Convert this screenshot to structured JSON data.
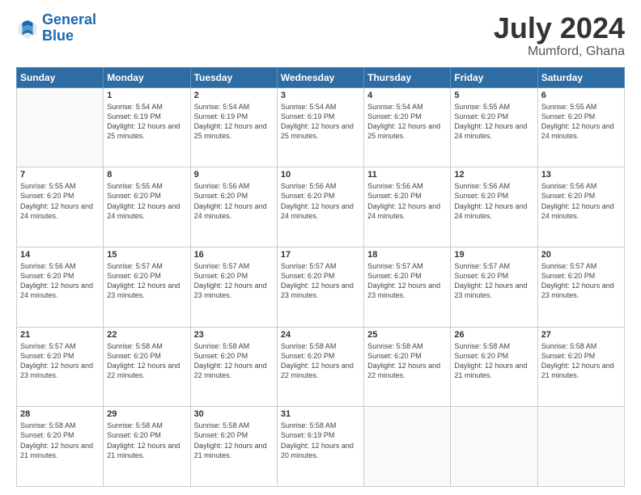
{
  "header": {
    "logo_line1": "General",
    "logo_line2": "Blue",
    "title": "July 2024",
    "subtitle": "Mumford, Ghana"
  },
  "weekdays": [
    "Sunday",
    "Monday",
    "Tuesday",
    "Wednesday",
    "Thursday",
    "Friday",
    "Saturday"
  ],
  "weeks": [
    [
      {
        "day": "",
        "info": ""
      },
      {
        "day": "1",
        "info": "Sunrise: 5:54 AM\nSunset: 6:19 PM\nDaylight: 12 hours\nand 25 minutes."
      },
      {
        "day": "2",
        "info": "Sunrise: 5:54 AM\nSunset: 6:19 PM\nDaylight: 12 hours\nand 25 minutes."
      },
      {
        "day": "3",
        "info": "Sunrise: 5:54 AM\nSunset: 6:19 PM\nDaylight: 12 hours\nand 25 minutes."
      },
      {
        "day": "4",
        "info": "Sunrise: 5:54 AM\nSunset: 6:20 PM\nDaylight: 12 hours\nand 25 minutes."
      },
      {
        "day": "5",
        "info": "Sunrise: 5:55 AM\nSunset: 6:20 PM\nDaylight: 12 hours\nand 24 minutes."
      },
      {
        "day": "6",
        "info": "Sunrise: 5:55 AM\nSunset: 6:20 PM\nDaylight: 12 hours\nand 24 minutes."
      }
    ],
    [
      {
        "day": "7",
        "info": ""
      },
      {
        "day": "8",
        "info": "Sunrise: 5:55 AM\nSunset: 6:20 PM\nDaylight: 12 hours\nand 24 minutes."
      },
      {
        "day": "9",
        "info": "Sunrise: 5:56 AM\nSunset: 6:20 PM\nDaylight: 12 hours\nand 24 minutes."
      },
      {
        "day": "10",
        "info": "Sunrise: 5:56 AM\nSunset: 6:20 PM\nDaylight: 12 hours\nand 24 minutes."
      },
      {
        "day": "11",
        "info": "Sunrise: 5:56 AM\nSunset: 6:20 PM\nDaylight: 12 hours\nand 24 minutes."
      },
      {
        "day": "12",
        "info": "Sunrise: 5:56 AM\nSunset: 6:20 PM\nDaylight: 12 hours\nand 24 minutes."
      },
      {
        "day": "13",
        "info": "Sunrise: 5:56 AM\nSunset: 6:20 PM\nDaylight: 12 hours\nand 24 minutes."
      }
    ],
    [
      {
        "day": "14",
        "info": ""
      },
      {
        "day": "15",
        "info": "Sunrise: 5:57 AM\nSunset: 6:20 PM\nDaylight: 12 hours\nand 23 minutes."
      },
      {
        "day": "16",
        "info": "Sunrise: 5:57 AM\nSunset: 6:20 PM\nDaylight: 12 hours\nand 23 minutes."
      },
      {
        "day": "17",
        "info": "Sunrise: 5:57 AM\nSunset: 6:20 PM\nDaylight: 12 hours\nand 23 minutes."
      },
      {
        "day": "18",
        "info": "Sunrise: 5:57 AM\nSunset: 6:20 PM\nDaylight: 12 hours\nand 23 minutes."
      },
      {
        "day": "19",
        "info": "Sunrise: 5:57 AM\nSunset: 6:20 PM\nDaylight: 12 hours\nand 23 minutes."
      },
      {
        "day": "20",
        "info": "Sunrise: 5:57 AM\nSunset: 6:20 PM\nDaylight: 12 hours\nand 23 minutes."
      }
    ],
    [
      {
        "day": "21",
        "info": ""
      },
      {
        "day": "22",
        "info": "Sunrise: 5:58 AM\nSunset: 6:20 PM\nDaylight: 12 hours\nand 22 minutes."
      },
      {
        "day": "23",
        "info": "Sunrise: 5:58 AM\nSunset: 6:20 PM\nDaylight: 12 hours\nand 22 minutes."
      },
      {
        "day": "24",
        "info": "Sunrise: 5:58 AM\nSunset: 6:20 PM\nDaylight: 12 hours\nand 22 minutes."
      },
      {
        "day": "25",
        "info": "Sunrise: 5:58 AM\nSunset: 6:20 PM\nDaylight: 12 hours\nand 22 minutes."
      },
      {
        "day": "26",
        "info": "Sunrise: 5:58 AM\nSunset: 6:20 PM\nDaylight: 12 hours\nand 21 minutes."
      },
      {
        "day": "27",
        "info": "Sunrise: 5:58 AM\nSunset: 6:20 PM\nDaylight: 12 hours\nand 21 minutes."
      }
    ],
    [
      {
        "day": "28",
        "info": "Sunrise: 5:58 AM\nSunset: 6:20 PM\nDaylight: 12 hours\nand 21 minutes."
      },
      {
        "day": "29",
        "info": "Sunrise: 5:58 AM\nSunset: 6:20 PM\nDaylight: 12 hours\nand 21 minutes."
      },
      {
        "day": "30",
        "info": "Sunrise: 5:58 AM\nSunset: 6:20 PM\nDaylight: 12 hours\nand 21 minutes."
      },
      {
        "day": "31",
        "info": "Sunrise: 5:58 AM\nSunset: 6:19 PM\nDaylight: 12 hours\nand 20 minutes."
      },
      {
        "day": "",
        "info": ""
      },
      {
        "day": "",
        "info": ""
      },
      {
        "day": "",
        "info": ""
      }
    ]
  ],
  "week7_sunday": "Sunrise: 5:55 AM\nSunset: 6:20 PM\nDaylight: 12 hours\nand 24 minutes.",
  "week14_sunday": "Sunrise: 5:56 AM\nSunset: 6:20 PM\nDaylight: 12 hours\nand 24 minutes.",
  "week21_sunday": "Sunrise: 5:57 AM\nSunset: 6:20 PM\nDaylight: 12 hours\nand 23 minutes.",
  "week21b_sunday": "Sunrise: 5:58 AM\nSunset: 6:20 PM\nDaylight: 12 hours\nand 22 minutes."
}
